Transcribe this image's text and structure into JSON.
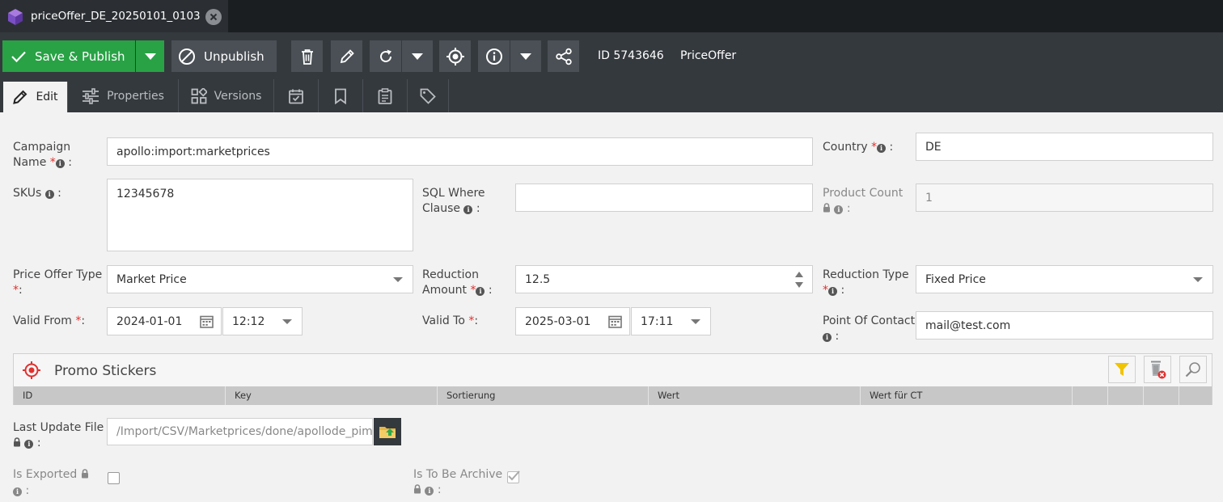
{
  "tab": {
    "title": "priceOffer_DE_20250101_0103"
  },
  "toolbar": {
    "save_label": "Save & Publish",
    "unpublish_label": "Unpublish",
    "id_text": "ID 5743646",
    "class_text": "PriceOffer"
  },
  "subtabs": {
    "edit": "Edit",
    "properties": "Properties",
    "versions": "Versions"
  },
  "form": {
    "campaign_name": {
      "label1": "Campaign",
      "label2": "Name",
      "value": "apollo:import:marketprices"
    },
    "country": {
      "label": "Country",
      "value": "DE"
    },
    "skus": {
      "label": "SKUs",
      "value": "12345678"
    },
    "sql_where": {
      "label1": "SQL Where",
      "label2": "Clause",
      "value": ""
    },
    "product_count": {
      "label": "Product Count",
      "value": "1"
    },
    "price_offer_type": {
      "label": "Price Offer Type",
      "value": "Market Price"
    },
    "reduction_amount": {
      "label1": "Reduction",
      "label2": "Amount",
      "value": "12.5"
    },
    "reduction_type": {
      "label": "Reduction Type",
      "value": "Fixed Price"
    },
    "valid_from": {
      "label": "Valid From",
      "date": "2024-01-01",
      "time": "12:12"
    },
    "valid_to": {
      "label": "Valid To",
      "date": "2025-03-01",
      "time": "17:11"
    },
    "point_of_contact": {
      "label": "Point Of Contact",
      "value": "mail@test.com"
    },
    "last_update_file": {
      "label": "Last Update File",
      "value": "/Import/CSV/Marketprices/done/apollode_pim"
    },
    "is_exported": {
      "label": "Is Exported",
      "checked": false
    },
    "is_to_be_archive": {
      "label": "Is To Be Archive",
      "checked": true
    }
  },
  "promo_grid": {
    "title": "Promo Stickers",
    "columns": [
      "ID",
      "Key",
      "Sortierung",
      "Wert",
      "Wert für CT",
      "",
      "",
      "",
      ""
    ]
  },
  "colors": {
    "save": "#28a245",
    "toolbar": "#34393e",
    "required": "#e0312f",
    "accent": "#e0312f"
  }
}
